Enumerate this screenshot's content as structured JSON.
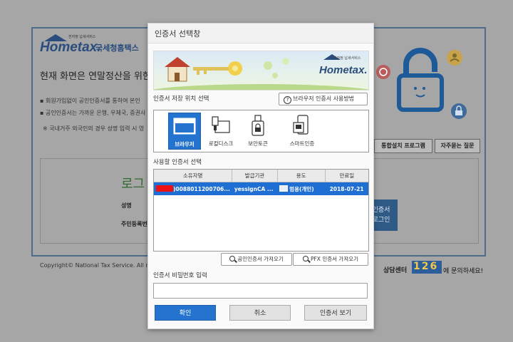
{
  "background": {
    "logo": {
      "word": "Hometax.",
      "korean": "국세청홈택스",
      "tagline": "전자정 납세서비스"
    },
    "headline": "현재 화면은 연말정산을 위한 로",
    "bullets": [
      "▪ 회원가입없이 공인인증서를 통하여 본인",
      "▪ 공인인증서는 가까운 은행, 우체국, 증권사",
      "※ 국내거주 외국인의 경우 성명 입력 시 영"
    ],
    "install_button": "통합설치 프로그램",
    "faq_button": "자주묻는 질문",
    "login_title": "로그",
    "name_label": "성명",
    "rrn_label": "주민등록번",
    "cert_login_button_line1": "인증서",
    "cert_login_button_line2": "로그인",
    "copyright": "Copyright© National Tax Service. All ri",
    "help_prefix": "상담센터",
    "help_number": "126",
    "help_suffix": "에 문의하세요!"
  },
  "dialog": {
    "title": "인증서 선택창",
    "banner_logo": "Hometax.",
    "banner_tag": "전자정 납세서비스",
    "storage_label": "인증서 저장 위치 선택",
    "browser_help_button": "브라우저 인증서 사용방법",
    "storage_options": [
      {
        "label": "브라우저",
        "icon": "browser-window-icon",
        "selected": true
      },
      {
        "label": "로컬디스크",
        "icon": "local-disk-icon",
        "selected": false
      },
      {
        "label": "보안토큰",
        "icon": "security-token-icon",
        "selected": false
      },
      {
        "label": "스마트인증",
        "icon": "smart-auth-icon",
        "selected": false
      }
    ],
    "cert_list_label": "사용할 인증서 선택",
    "columns": [
      "소유자명",
      "발급기관",
      "용도",
      "만료일"
    ],
    "rows": [
      {
        "owner": ")0088011200706...",
        "issuer": "yessignCA ...",
        "usage": "범용(개인)",
        "expiry": "2018-07-21",
        "selected": true
      }
    ],
    "import_public_button": "공인인증서 가져오기",
    "import_pfx_button": "PFX 인증서 가져오기",
    "password_label": "인증서 비밀번호 입력",
    "password_value": "",
    "ok_button": "확인",
    "cancel_button": "취소",
    "view_button": "인증서 보기",
    "colors": {
      "accent": "#2474cf",
      "selection": "#1f6ed4",
      "redaction": "#ee1111"
    }
  }
}
